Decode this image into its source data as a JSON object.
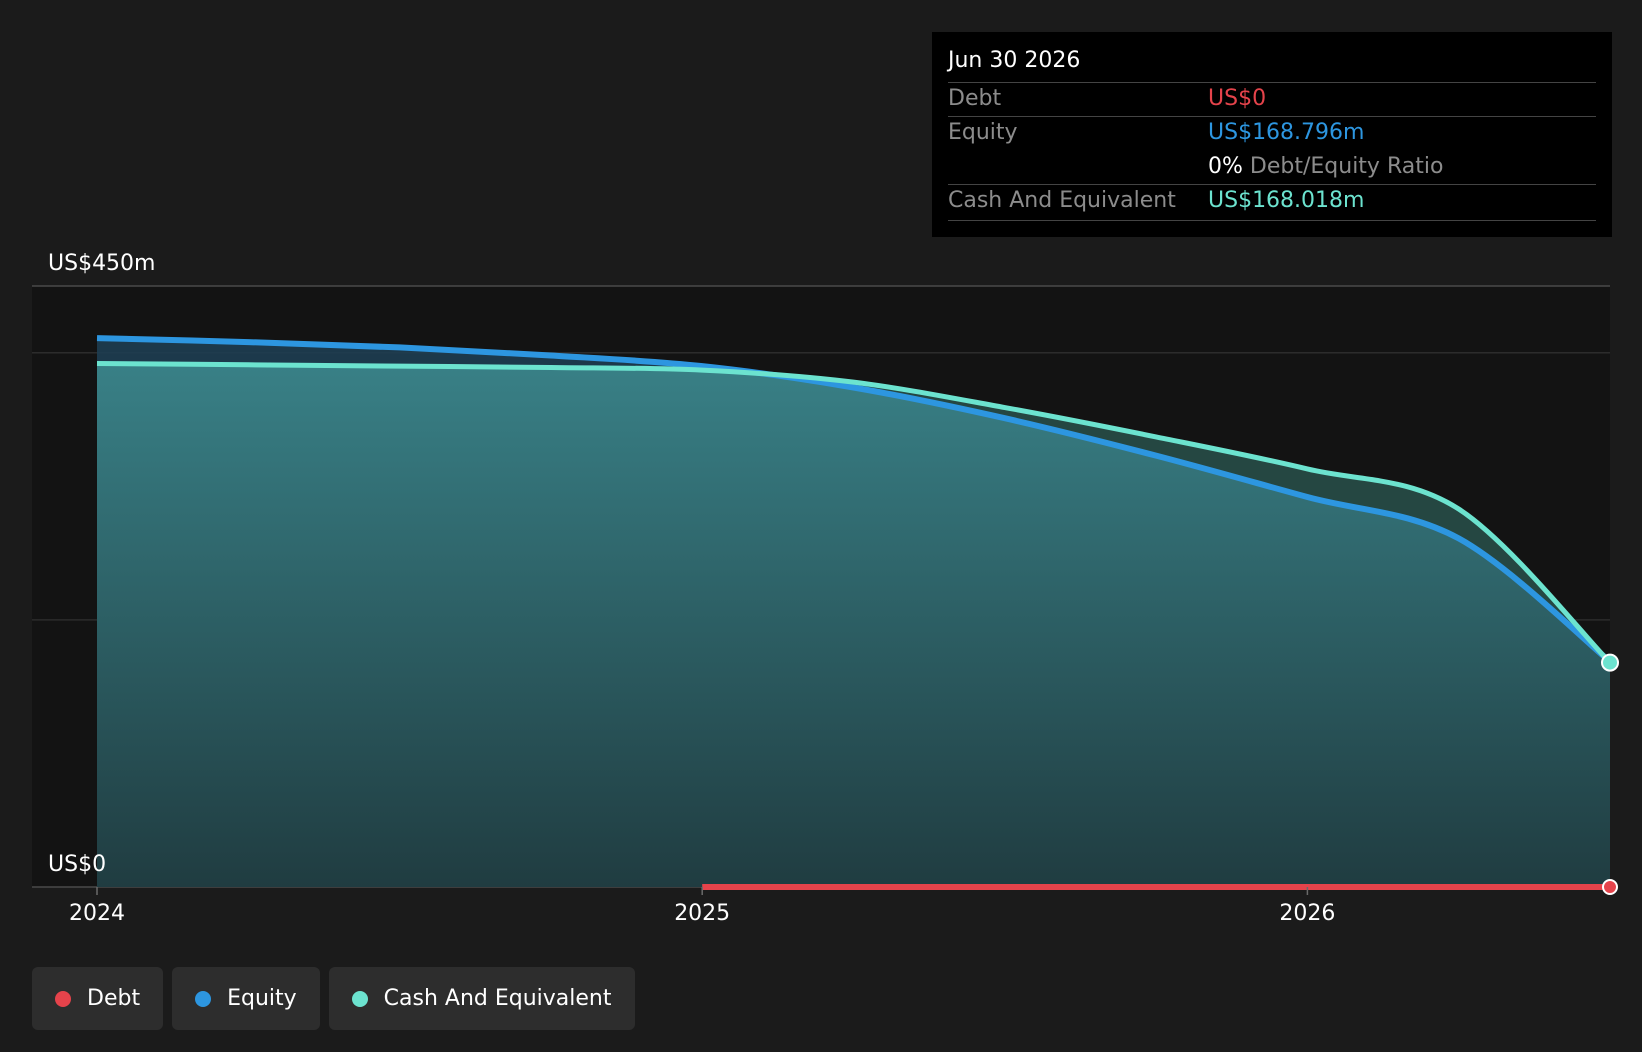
{
  "tooltip": {
    "date": "Jun 30 2026",
    "debt_label": "Debt",
    "debt_value": "US$0",
    "equity_label": "Equity",
    "equity_value": "US$168.796m",
    "ratio_value": "0%",
    "ratio_label": "Debt/Equity Ratio",
    "cash_label": "Cash And Equivalent",
    "cash_value": "US$168.018m"
  },
  "legend": {
    "debt": "Debt",
    "equity": "Equity",
    "cash": "Cash And Equivalent"
  },
  "colors": {
    "debt": "#e5434b",
    "equity": "#2d96e0",
    "cash": "#6ce3cf",
    "background": "#1b1b1b",
    "plot_background": "#131313"
  },
  "chart_data": {
    "type": "area",
    "y_tick_labels": [
      "US$450m",
      "US$0"
    ],
    "x_tick_labels": [
      "2024",
      "2025",
      "2026"
    ],
    "ylim": [
      0,
      450
    ],
    "x_ticks": [
      2024.0,
      2025.0,
      2026.0
    ],
    "xlim": [
      2023.89,
      2026.5
    ],
    "gridlines_y": [
      0,
      200,
      400
    ],
    "series": [
      {
        "name": "Debt",
        "key": "debt",
        "x": [
          2025.0,
          2025.25,
          2025.5,
          2025.75,
          2026.0,
          2026.25,
          2026.5
        ],
        "values": [
          0,
          0,
          0,
          0,
          0,
          0,
          0
        ]
      },
      {
        "name": "Equity",
        "key": "equity",
        "x": [
          2024.0,
          2024.25,
          2024.5,
          2024.75,
          2025.0,
          2025.25,
          2025.5,
          2025.75,
          2026.0,
          2026.25,
          2026.5
        ],
        "values": [
          411,
          408,
          404,
          398,
          390,
          374,
          351,
          323,
          292,
          261,
          168.796
        ]
      },
      {
        "name": "Cash And Equivalent",
        "key": "cash",
        "x": [
          2024.0,
          2024.25,
          2024.5,
          2024.75,
          2025.0,
          2025.25,
          2025.5,
          2025.75,
          2026.0,
          2026.25,
          2026.5
        ],
        "values": [
          392,
          391,
          390,
          389,
          387,
          378,
          359,
          337,
          313,
          283,
          168.018
        ]
      }
    ]
  }
}
